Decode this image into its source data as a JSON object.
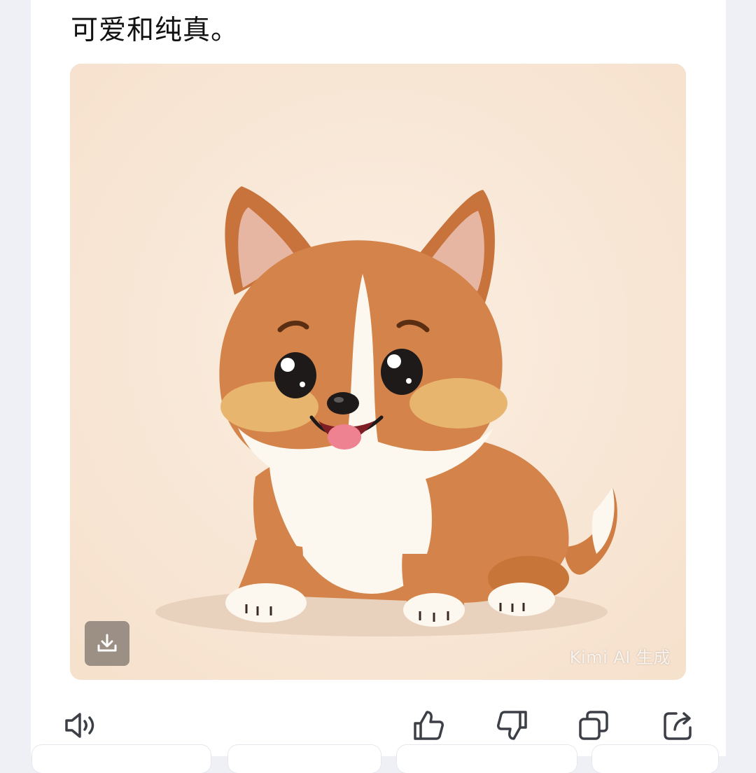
{
  "message": {
    "text": "可爱和纯真。"
  },
  "image": {
    "subject_icon": "corgi-puppy-illustration",
    "background_color": "#f8e6d5",
    "watermark": "Kimi AI 生成",
    "download_icon": "download-icon"
  },
  "actions": {
    "icons": [
      "speaker-icon",
      "thumbs-up-icon",
      "thumbs-down-icon",
      "copy-icon",
      "share-icon"
    ]
  },
  "colors": {
    "fur_orange": "#d4844a",
    "fur_white": "#fdf8ef",
    "icon_gray": "#3d3f47"
  }
}
